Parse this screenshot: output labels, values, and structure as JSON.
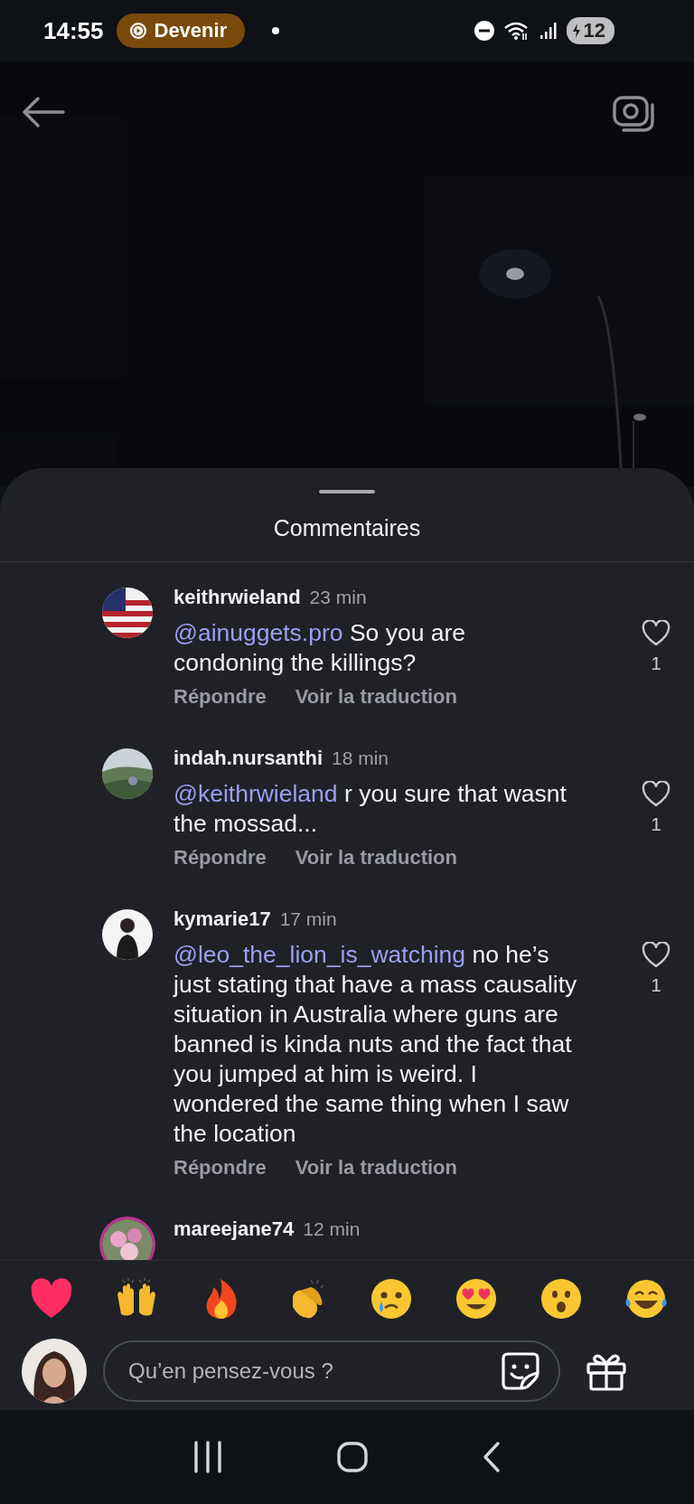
{
  "status_bar": {
    "time": "14:55",
    "pill": "Devenir",
    "battery": "12"
  },
  "sheet": {
    "title": "Commentaires"
  },
  "comments": [
    {
      "username": "keithrwieland",
      "time": "23 min",
      "mention": "@ainuggets.pro",
      "text": "So you are condoning the killings?",
      "likes": "1",
      "liked": false,
      "reply": "Répondre",
      "translate": "Voir la traduction"
    },
    {
      "username": "indah.nursanthi",
      "time": "18 min",
      "mention": "@keithrwieland",
      "text": "r you sure that wasnt the mossad...",
      "likes": "1",
      "liked": false,
      "reply": "Répondre",
      "translate": "Voir la traduction"
    },
    {
      "username": "kymarie17",
      "time": "17 min",
      "mention": "@leo_the_lion_is_watching",
      "text": "no he’s just stating that have a mass causality situation in Australia where guns are banned is kinda nuts and the fact that you jumped at him is weird. I wondered the same thing when I saw the location",
      "likes": "1",
      "liked": false,
      "reply": "Répondre",
      "translate": "Voir la traduction"
    },
    {
      "username": "mareejane74",
      "time": "12 min"
    }
  ],
  "composer": {
    "placeholder": "Qu’en pensez-vous ?"
  }
}
